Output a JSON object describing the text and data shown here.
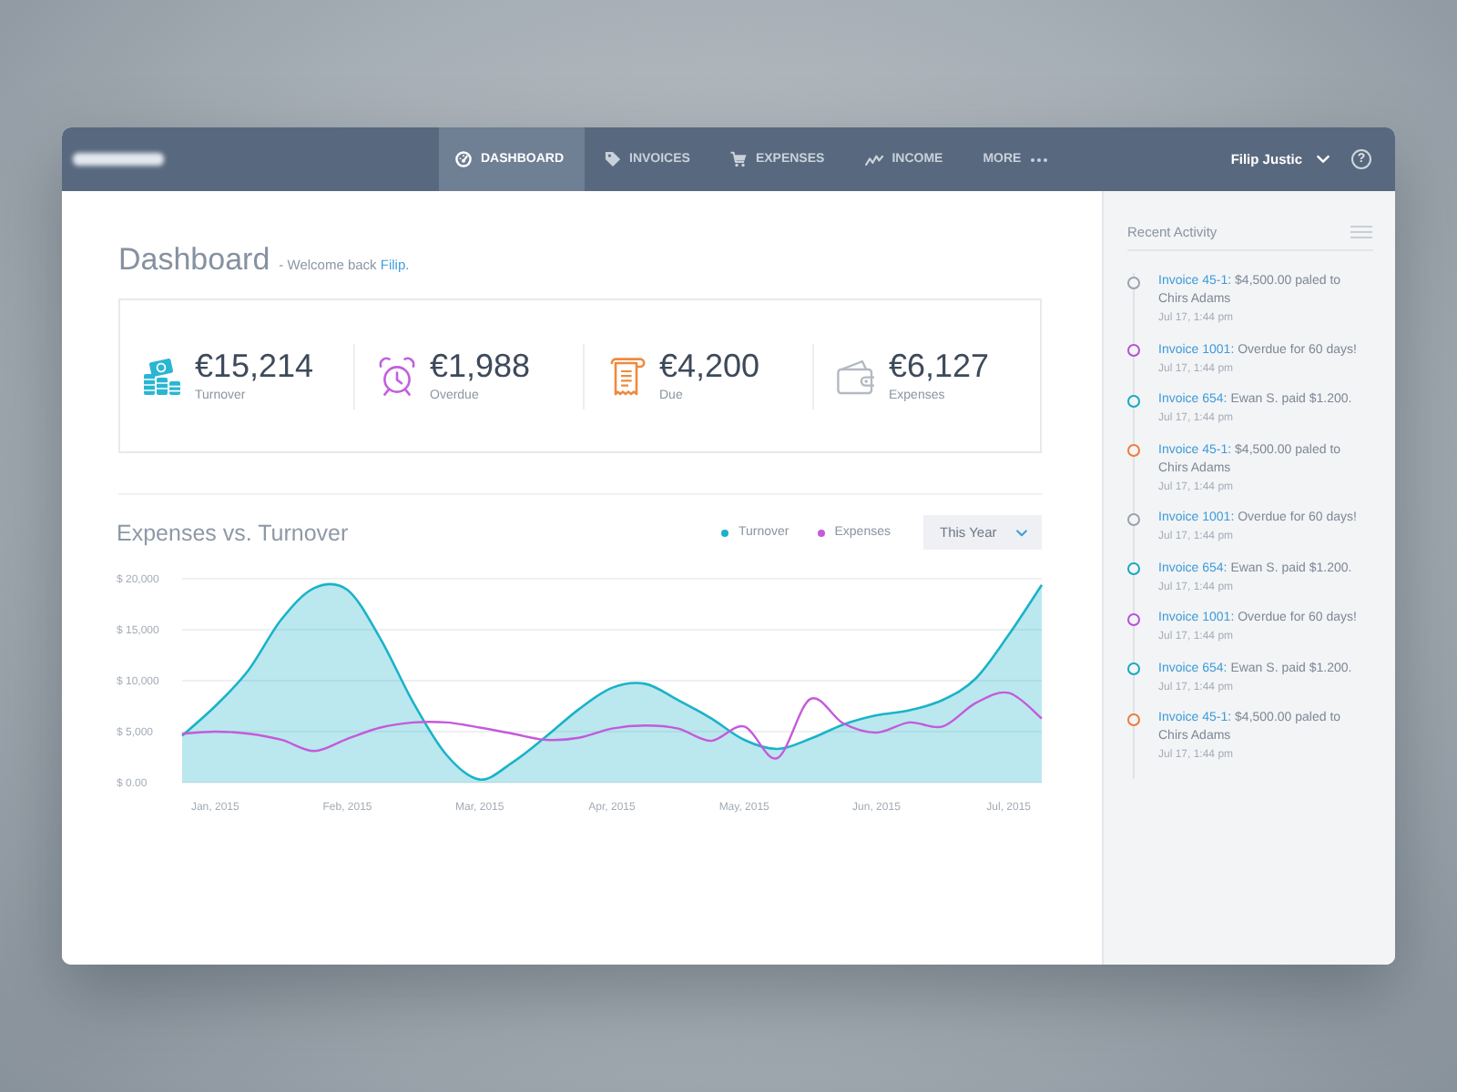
{
  "nav": {
    "tabs": [
      {
        "label": "DASHBOARD",
        "selected": true
      },
      {
        "label": "INVOICES",
        "selected": false
      },
      {
        "label": "EXPENSES",
        "selected": false
      },
      {
        "label": "INCOME",
        "selected": false
      },
      {
        "label": "MORE",
        "selected": false
      }
    ],
    "user": {
      "name": "Filip Justic"
    },
    "help": {
      "label": "?"
    }
  },
  "header": {
    "title": "Dashboard",
    "welcome": "- Welcome back",
    "name": "Filip."
  },
  "stats": [
    {
      "value": "€15,214",
      "label": "Turnover",
      "color": "#2ab6d3"
    },
    {
      "value": "€1,988",
      "label": "Overdue",
      "color": "#c25fe0"
    },
    {
      "value": "€4,200",
      "label": "Due",
      "color": "#ef8a3e"
    },
    {
      "value": "€6,127",
      "label": "Expenses",
      "color": "#b3b9c1"
    }
  ],
  "chart": {
    "filter": {
      "label": "This Year"
    },
    "chart_data": {
      "type": "area",
      "title": "Expenses vs. Turnover",
      "grid": true,
      "categories": [
        null,
        "Jan, 2015",
        null,
        null,
        null,
        "Feb, 2015",
        null,
        null,
        null,
        "Mar, 2015",
        null,
        null,
        null,
        "Apr, 2015",
        null,
        null,
        null,
        "May, 2015",
        null,
        null,
        null,
        "Jun, 2015",
        null,
        null,
        null,
        "Jul, 2015",
        null
      ],
      "ylim": [
        0,
        20000
      ],
      "yticks": [
        {
          "value": 0,
          "label": "$ 0.00"
        },
        {
          "value": 5000,
          "label": "$ 5,000"
        },
        {
          "value": 10000,
          "label": "$ 10,000"
        },
        {
          "value": 15000,
          "label": "$ 15,000"
        },
        {
          "value": 20000,
          "label": "$ 20,000"
        }
      ],
      "series": [
        {
          "name": "Turnover",
          "color": "#1ab3c8",
          "values": [
            4600,
            7500,
            11000,
            16000,
            19100,
            18900,
            14100,
            7800,
            2700,
            300,
            2000,
            4500,
            7200,
            9300,
            9700,
            8100,
            6300,
            4200,
            3300,
            4300,
            5700,
            6600,
            7100,
            8100,
            10200,
            14500,
            19400
          ]
        },
        {
          "name": "Expenses",
          "type": "line",
          "color": "#c55adb",
          "values": [
            4800,
            5000,
            4800,
            4200,
            3100,
            4300,
            5400,
            5900,
            5900,
            5400,
            4800,
            4200,
            4400,
            5300,
            5600,
            5300,
            4100,
            5500,
            2400,
            8200,
            5800,
            4900,
            5900,
            5500,
            7800,
            8800,
            6300
          ]
        }
      ]
    }
  },
  "activity": {
    "title": "Recent Activity",
    "items": [
      {
        "link": "Invoice 45-1:",
        "text": "$4,500.00 paled to Chirs Adams",
        "time": "Jul 17, 1:44 pm",
        "color": "#9aa2ab"
      },
      {
        "link": "Invoice 1001:",
        "text": "Overdue for 60 days!",
        "time": "Jul 17, 1:44 pm",
        "color": "#b650d8"
      },
      {
        "link": "Invoice 654:",
        "text": "Ewan S. paid $1.200.",
        "time": "Jul 17, 1:44 pm",
        "color": "#17a9c0"
      },
      {
        "link": "Invoice 45-1:",
        "text": "$4,500.00 paled to Chirs Adams",
        "time": "Jul 17, 1:44 pm",
        "color": "#ee7b3b"
      },
      {
        "link": "Invoice 1001:",
        "text": "Overdue for 60 days!",
        "time": "Jul 17, 1:44 pm",
        "color": "#9aa2ab"
      },
      {
        "link": "Invoice 654:",
        "text": "Ewan S. paid $1.200.",
        "time": "Jul 17, 1:44 pm",
        "color": "#17a9c0"
      },
      {
        "link": "Invoice 1001:",
        "text": "Overdue for 60 days!",
        "time": "Jul 17, 1:44 pm",
        "color": "#b650d8"
      },
      {
        "link": "Invoice 654:",
        "text": "Ewan S. paid $1.200.",
        "time": "Jul 17, 1:44 pm",
        "color": "#17a9c0"
      },
      {
        "link": "Invoice 45-1:",
        "text": "$4,500.00 paled to Chirs Adams",
        "time": "Jul 17, 1:44 pm",
        "color": "#ee7b3b"
      }
    ]
  }
}
